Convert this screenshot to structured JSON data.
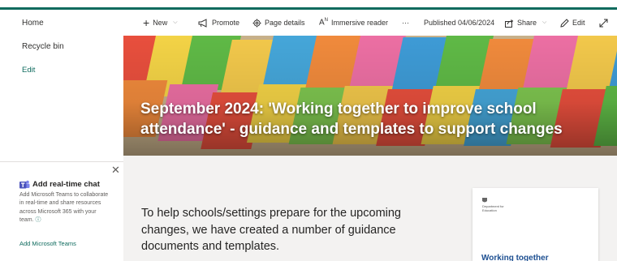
{
  "nav": {
    "home": "Home",
    "recycle_bin": "Recycle bin",
    "edit": "Edit"
  },
  "chat_panel": {
    "close_icon": "close-icon",
    "title": "Add real-time chat",
    "description": "Add Microsoft Teams to collaborate in real-time and share resources across Microsoft 365 with your team.",
    "link": "Add Microsoft Teams"
  },
  "command_bar": {
    "new": "New",
    "promote": "Promote",
    "page_details": "Page details",
    "immersive_reader": "Immersive reader",
    "more": "···",
    "published": "Published 04/06/2024",
    "share": "Share",
    "edit": "Edit"
  },
  "hero": {
    "title": "September 2024: 'Working together to improve school attendance' - guidance and templates to support changes"
  },
  "content": {
    "intro": "To help schools/settings prepare for the upcoming changes, we have created a number of guidance documents and templates.",
    "document": {
      "publisher": "Department for Education",
      "heading": "Working together"
    }
  },
  "colors": {
    "accent": "#0f6b5e",
    "link": "#0f6b5e",
    "body_bg": "#f3f2f1",
    "doc_heading": "#1d4f91"
  }
}
